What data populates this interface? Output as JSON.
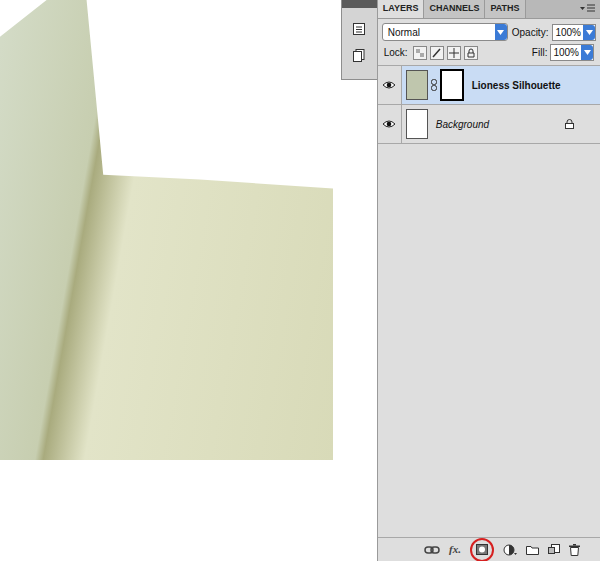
{
  "tabs": [
    {
      "label": "LAYERS",
      "selected": true
    },
    {
      "label": "CHANNELS",
      "selected": false
    },
    {
      "label": "PATHS",
      "selected": false
    }
  ],
  "blend_mode": "Normal",
  "opacity": {
    "label": "Opacity:",
    "value": "100%"
  },
  "lock": {
    "label": "Lock:"
  },
  "fill": {
    "label": "Fill:",
    "value": "100%"
  },
  "layers": [
    {
      "name": "Lioness Silhouette",
      "selected": true,
      "visible": true,
      "has_mask": true,
      "locked": false,
      "italic": false
    },
    {
      "name": "Background",
      "selected": false,
      "visible": true,
      "has_mask": false,
      "locked": true,
      "italic": true
    }
  ],
  "bottom_bar": [
    {
      "kind": "link",
      "highlighted": false
    },
    {
      "kind": "fx",
      "label": "fx.",
      "highlighted": false
    },
    {
      "kind": "mask",
      "highlighted": true
    },
    {
      "kind": "adjustment",
      "highlighted": false
    },
    {
      "kind": "group",
      "highlighted": false
    },
    {
      "kind": "new",
      "highlighted": false
    },
    {
      "kind": "trash",
      "highlighted": false
    }
  ]
}
